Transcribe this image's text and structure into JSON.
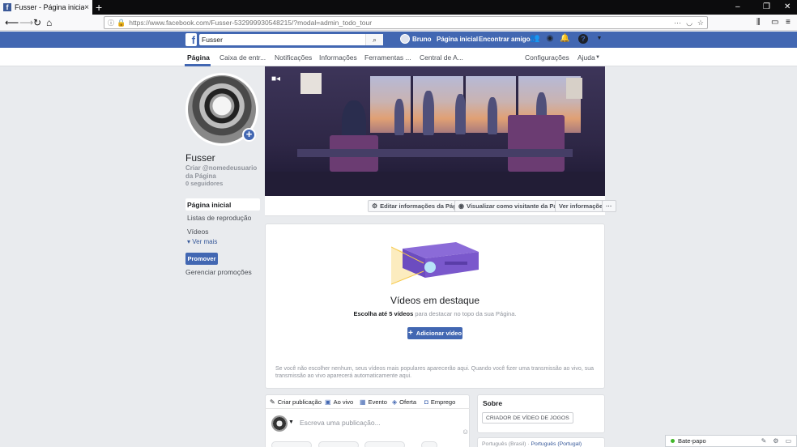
{
  "browser": {
    "tab_title": "Fusser - Página inicial",
    "tab_close": "×",
    "new_tab": "+",
    "url": "https://www.facebook.com/Fusser-532999930548215/?modal=admin_todo_tour",
    "window_minimize": "–",
    "window_restore": "❐",
    "window_close": "✕"
  },
  "fb_header": {
    "logo": "f",
    "search_value": "Fusser",
    "user_name": "Bruno",
    "home_link": "Página inicial",
    "find_friends": "Encontrar amigos",
    "help_icon": "?"
  },
  "page_nav": {
    "items": [
      "Página",
      "Caixa de entr...",
      "Notificações",
      "Informações",
      "Ferramentas ...",
      "Central de A..."
    ],
    "settings": "Configurações",
    "help": "Ajuda"
  },
  "profile": {
    "name": "Fusser",
    "username_prompt": "Criar @nomedeusuario da Página",
    "followers": "0 seguidores",
    "add_icon": "+"
  },
  "left_nav": {
    "items": [
      "Página inicial",
      "Listas de reprodução",
      "Vídeos"
    ],
    "see_more": "Ver mais",
    "promote": "Promover",
    "manage_promotions": "Gerenciar promoções"
  },
  "cover_actions": {
    "edit_info": "Editar informações da Página",
    "view_as_visitor": "Visualizar como visitante da Página",
    "view_info": "Ver informações",
    "more": "···"
  },
  "featured": {
    "title": "Vídeos em destaque",
    "subtitle_bold": "Escolha até 5 vídeos",
    "subtitle_rest": " para destacar no topo da sua Página.",
    "add_button": "Adicionar vídeo",
    "note": "Se você não escolher nenhum, seus vídeos mais populares aparecerão aqui. Quando você fizer uma transmissão ao vivo, sua transmissão ao vivo aparecerá automaticamente aqui."
  },
  "composer": {
    "tabs": [
      "Criar publicação",
      "Ao vivo",
      "Evento",
      "Oferta",
      "Emprego"
    ],
    "placeholder": "Escreva uma publicação..."
  },
  "about": {
    "title": "Sobre",
    "category": "CRIADOR DE VÍDEO DE JOGOS",
    "lang_current": "Português (Brasil)",
    "lang_alt": "Português (Portugal)"
  },
  "chat": {
    "label": "Bate-papo"
  },
  "colors": {
    "fb_blue": "#4267b2",
    "online_green": "#42b72a"
  }
}
